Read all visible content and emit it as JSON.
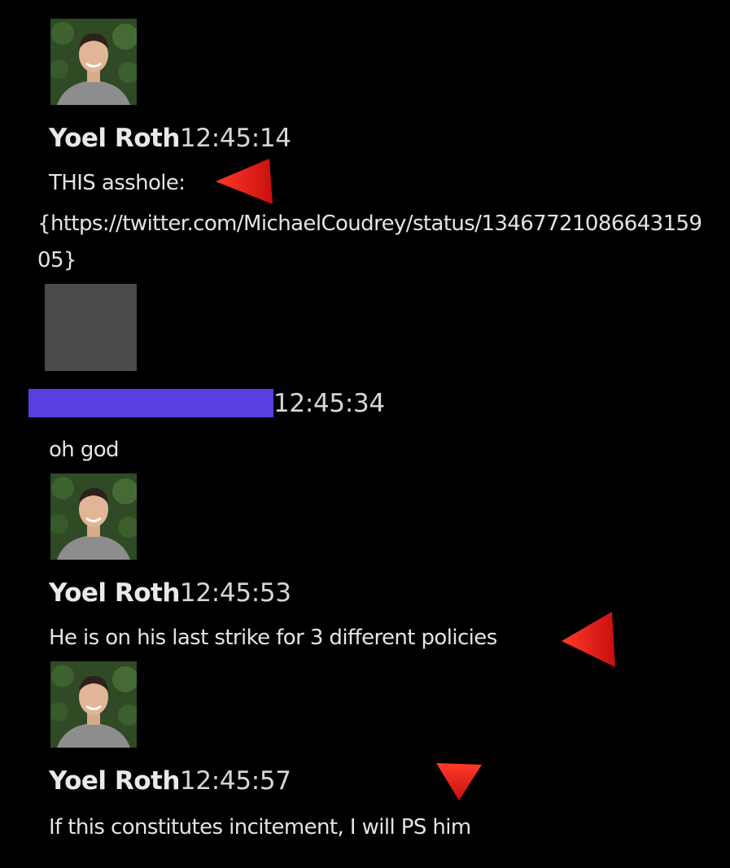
{
  "messages": [
    {
      "author": "Yoel Roth",
      "time": "12:45:14",
      "text": "THIS asshole:",
      "link": "{https://twitter.com/MichaelCoudrey/status/1346772108664315905}"
    },
    {
      "author": "",
      "time": "12:45:34",
      "text": "oh god"
    },
    {
      "author": "Yoel Roth",
      "time": "12:45:53",
      "text": "He is on his last strike for 3 different policies"
    },
    {
      "author": "Yoel Roth",
      "time": "12:45:57",
      "text": "If this constitutes incitement, I will PS him"
    }
  ],
  "colors": {
    "background": "#000000",
    "redaction": "#5b3ee0",
    "redacted_avatar": "#4a4a4a",
    "arrow": "#e01b1b",
    "text": "#e4e4e4"
  },
  "icons": {
    "annotation": "red-triangle-arrow",
    "avatar": "profile-photo"
  }
}
